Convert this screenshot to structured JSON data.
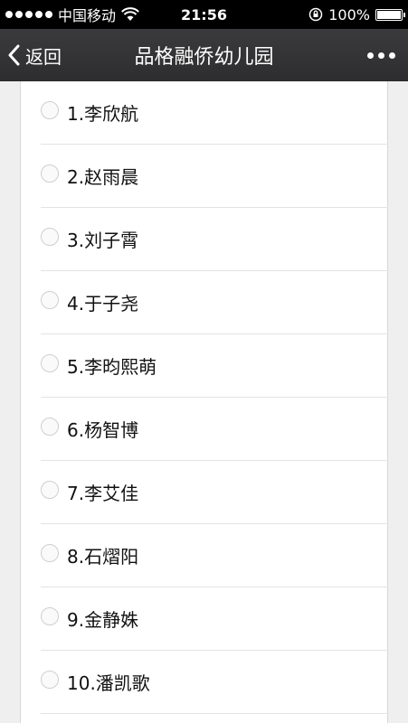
{
  "statusbar": {
    "carrier": "中国移动",
    "time": "21:56",
    "battery_text": "100%"
  },
  "navbar": {
    "back_label": "返回",
    "title": "品格融侨幼儿园"
  },
  "options": [
    {
      "label": "1.李欣航"
    },
    {
      "label": "2.赵雨晨"
    },
    {
      "label": "3.刘子霄"
    },
    {
      "label": "4.于子尧"
    },
    {
      "label": "5.李昀熙萌"
    },
    {
      "label": "6.杨智博"
    },
    {
      "label": "7.李艾佳"
    },
    {
      "label": "8.石熠阳"
    },
    {
      "label": "9.金静姝"
    },
    {
      "label": "10.潘凯歌"
    }
  ]
}
